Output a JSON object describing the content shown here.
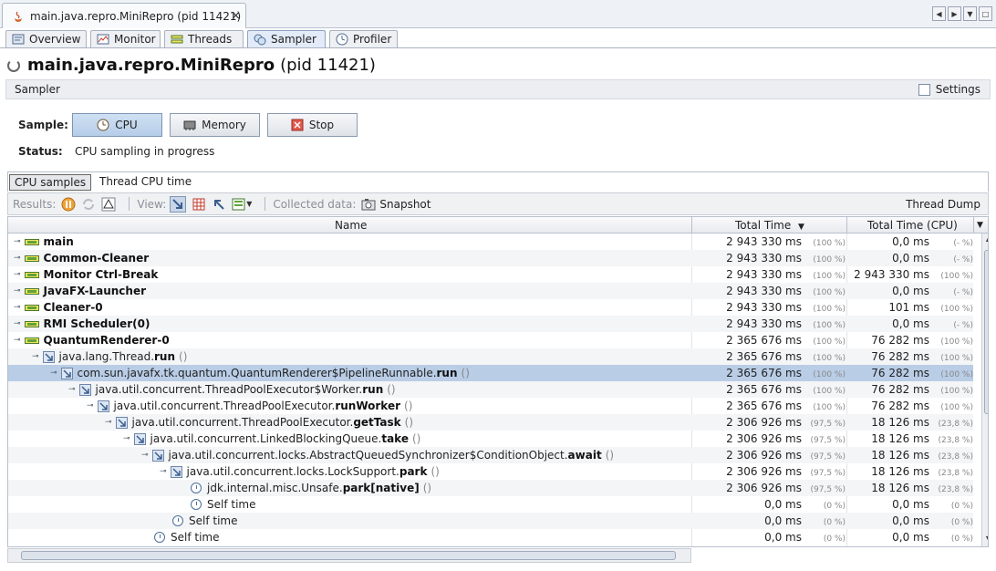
{
  "window": {
    "tab_title": "main.java.repro.MiniRepro (pid 11421)",
    "close_glyph": "×"
  },
  "view_tabs": [
    {
      "label": "Overview",
      "icon": "overview-icon"
    },
    {
      "label": "Monitor",
      "icon": "monitor-icon"
    },
    {
      "label": "Threads",
      "icon": "threads-icon"
    },
    {
      "label": "Sampler",
      "icon": "sampler-icon",
      "active": true
    },
    {
      "label": "Profiler",
      "icon": "profiler-icon"
    }
  ],
  "app": {
    "name": "main.java.repro.MiniRepro",
    "pid": "(pid 11421)"
  },
  "sampler": {
    "header": "Sampler",
    "settings_label": "Settings",
    "sample_label": "Sample:",
    "buttons": {
      "cpu": "CPU",
      "memory": "Memory",
      "stop": "Stop"
    },
    "status_label": "Status:",
    "status_value": "CPU sampling in progress"
  },
  "sub_tabs": {
    "cpu_samples": "CPU samples",
    "thread_cpu": "Thread CPU time"
  },
  "toolbar": {
    "results": "Results:",
    "view": "View:",
    "collected": "Collected data:",
    "snapshot": "Snapshot",
    "thread_dump": "Thread Dump"
  },
  "table": {
    "headers": {
      "name": "Name",
      "total": "Total Time",
      "cpu": "Total Time (CPU)"
    },
    "rows": [
      {
        "kind": "thread",
        "depth": 0,
        "name": "main",
        "total": "2 943 330 ms",
        "total_pct": "(100 %)",
        "cpu": "0,0 ms",
        "cpu_pct": "(- %)"
      },
      {
        "kind": "thread",
        "depth": 0,
        "name": "Common-Cleaner",
        "total": "2 943 330 ms",
        "total_pct": "(100 %)",
        "cpu": "0,0 ms",
        "cpu_pct": "(- %)"
      },
      {
        "kind": "thread",
        "depth": 0,
        "name": "Monitor Ctrl-Break",
        "total": "2 943 330 ms",
        "total_pct": "(100 %)",
        "cpu": "2 943 330 ms",
        "cpu_pct": "(100 %)"
      },
      {
        "kind": "thread",
        "depth": 0,
        "name": "JavaFX-Launcher",
        "total": "2 943 330 ms",
        "total_pct": "(100 %)",
        "cpu": "0,0 ms",
        "cpu_pct": "(- %)"
      },
      {
        "kind": "thread",
        "depth": 0,
        "name": "Cleaner-0",
        "total": "2 943 330 ms",
        "total_pct": "(100 %)",
        "cpu": "101 ms",
        "cpu_pct": "(100 %)"
      },
      {
        "kind": "thread",
        "depth": 0,
        "name": "RMI Scheduler(0)",
        "total": "2 943 330 ms",
        "total_pct": "(100 %)",
        "cpu": "0,0 ms",
        "cpu_pct": "(- %)"
      },
      {
        "kind": "thread",
        "depth": 0,
        "name": "QuantumRenderer-0",
        "total": "2 365 676 ms",
        "total_pct": "(100 %)",
        "cpu": "76 282 ms",
        "cpu_pct": "(100 %)"
      },
      {
        "kind": "method",
        "depth": 1,
        "pkg": "java.lang.Thread.",
        "meth": "run",
        "args": "()",
        "total": "2 365 676 ms",
        "total_pct": "(100 %)",
        "cpu": "76 282 ms",
        "cpu_pct": "(100 %)"
      },
      {
        "kind": "method",
        "depth": 2,
        "pkg": "com.sun.javafx.tk.quantum.QuantumRenderer$PipelineRunnable.",
        "meth": "run",
        "args": "()",
        "total": "2 365 676 ms",
        "total_pct": "(100 %)",
        "cpu": "76 282 ms",
        "cpu_pct": "(100 %)",
        "selected": true
      },
      {
        "kind": "method",
        "depth": 3,
        "pkg": "java.util.concurrent.ThreadPoolExecutor$Worker.",
        "meth": "run",
        "args": "()",
        "total": "2 365 676 ms",
        "total_pct": "(100 %)",
        "cpu": "76 282 ms",
        "cpu_pct": "(100 %)"
      },
      {
        "kind": "method",
        "depth": 4,
        "pkg": "java.util.concurrent.ThreadPoolExecutor.",
        "meth": "runWorker",
        "args": "()",
        "total": "2 365 676 ms",
        "total_pct": "(100 %)",
        "cpu": "76 282 ms",
        "cpu_pct": "(100 %)"
      },
      {
        "kind": "method",
        "depth": 5,
        "pkg": "java.util.concurrent.ThreadPoolExecutor.",
        "meth": "getTask",
        "args": "()",
        "total": "2 306 926 ms",
        "total_pct": "(97,5 %)",
        "cpu": "18 126 ms",
        "cpu_pct": "(23,8 %)"
      },
      {
        "kind": "method",
        "depth": 6,
        "pkg": "java.util.concurrent.LinkedBlockingQueue.",
        "meth": "take",
        "args": "()",
        "total": "2 306 926 ms",
        "total_pct": "(97,5 %)",
        "cpu": "18 126 ms",
        "cpu_pct": "(23,8 %)"
      },
      {
        "kind": "method",
        "depth": 7,
        "pkg": "java.util.concurrent.locks.AbstractQueuedSynchronizer$ConditionObject.",
        "meth": "await",
        "args": "()",
        "total": "2 306 926 ms",
        "total_pct": "(97,5 %)",
        "cpu": "18 126 ms",
        "cpu_pct": "(23,8 %)"
      },
      {
        "kind": "method",
        "depth": 8,
        "pkg": "java.util.concurrent.locks.LockSupport.",
        "meth": "park",
        "args": "()",
        "total": "2 306 926 ms",
        "total_pct": "(97,5 %)",
        "cpu": "18 126 ms",
        "cpu_pct": "(23,8 %)"
      },
      {
        "kind": "leaf",
        "depth": 9,
        "pkg": "jdk.internal.misc.Unsafe.",
        "meth": "park[native]",
        "args": "()",
        "total": "2 306 926 ms",
        "total_pct": "(97,5 %)",
        "cpu": "18 126 ms",
        "cpu_pct": "(23,8 %)"
      },
      {
        "kind": "self",
        "depth": 9,
        "pkg": "Self time",
        "total": "0,0 ms",
        "total_pct": "(0 %)",
        "cpu": "0,0 ms",
        "cpu_pct": "(0 %)"
      },
      {
        "kind": "self",
        "depth": 8,
        "pkg": "Self time",
        "total": "0,0 ms",
        "total_pct": "(0 %)",
        "cpu": "0,0 ms",
        "cpu_pct": "(0 %)"
      },
      {
        "kind": "self",
        "depth": 7,
        "pkg": "Self time",
        "total": "0,0 ms",
        "total_pct": "(0 %)",
        "cpu": "0,0 ms",
        "cpu_pct": "(0 %)"
      }
    ]
  }
}
